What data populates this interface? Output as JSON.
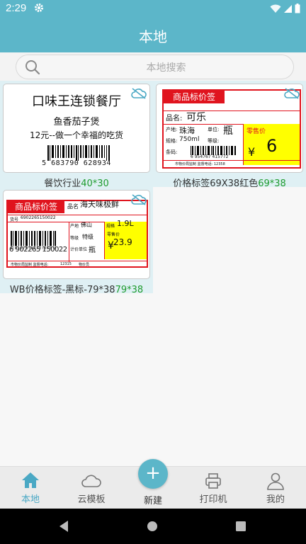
{
  "status": {
    "time": "2:29"
  },
  "header": {
    "title": "本地"
  },
  "search": {
    "placeholder": "本地搜索"
  },
  "templates": [
    {
      "name": "餐饮行业",
      "size": "40*30",
      "preview": {
        "store": "口味王连锁餐厅",
        "dish": "鱼香茄子煲",
        "slogan": "12元--做一个幸福的吃货",
        "barcode": "5 683790 628934"
      }
    },
    {
      "name": "价格标签69X38红色",
      "size": "69*38",
      "preview": {
        "heading": "商品标价签",
        "product_label": "品名:",
        "product": "可乐",
        "origin_label": "产地:",
        "origin": "珠海",
        "unit_label": "单位:",
        "unit": "瓶",
        "spec_label": "规格:",
        "spec": "750ml",
        "grade_label": "等级:",
        "code_label": "条码:",
        "barcode": "6 954767 415772",
        "price_label": "零售价",
        "currency": "¥",
        "price": "6",
        "footer": "市物价局监制  监督电话: 12358"
      }
    },
    {
      "name": "WB价格标签-黑标-79*38",
      "size": "79*38",
      "preview": {
        "heading": "商品标价签",
        "product_label": "品名",
        "product": "海天味极鲜",
        "code_label": "货号",
        "code": "6902265150022",
        "origin_label": "产地",
        "origin": "佛山",
        "spec_label": "规格",
        "spec": "1.9L",
        "grade_label": "等级",
        "grade": "特级",
        "unit_label": "计价单位",
        "unit": "瓶",
        "price_label": "零售价",
        "currency": "¥",
        "price": "23.9",
        "barcode": "6 902265 150022",
        "footer_a": "市物价局监制  监督电话:",
        "footer_b": "12315",
        "footer_c": "物价员"
      }
    }
  ],
  "nav": {
    "local": "本地",
    "cloud": "云模板",
    "new": "新建",
    "printer": "打印机",
    "mine": "我的"
  },
  "colors": {
    "accent": "#5cb6c9",
    "size_green": "#1e9b2e",
    "label_red": "#e0141e",
    "price_yellow": "#ffff00"
  }
}
